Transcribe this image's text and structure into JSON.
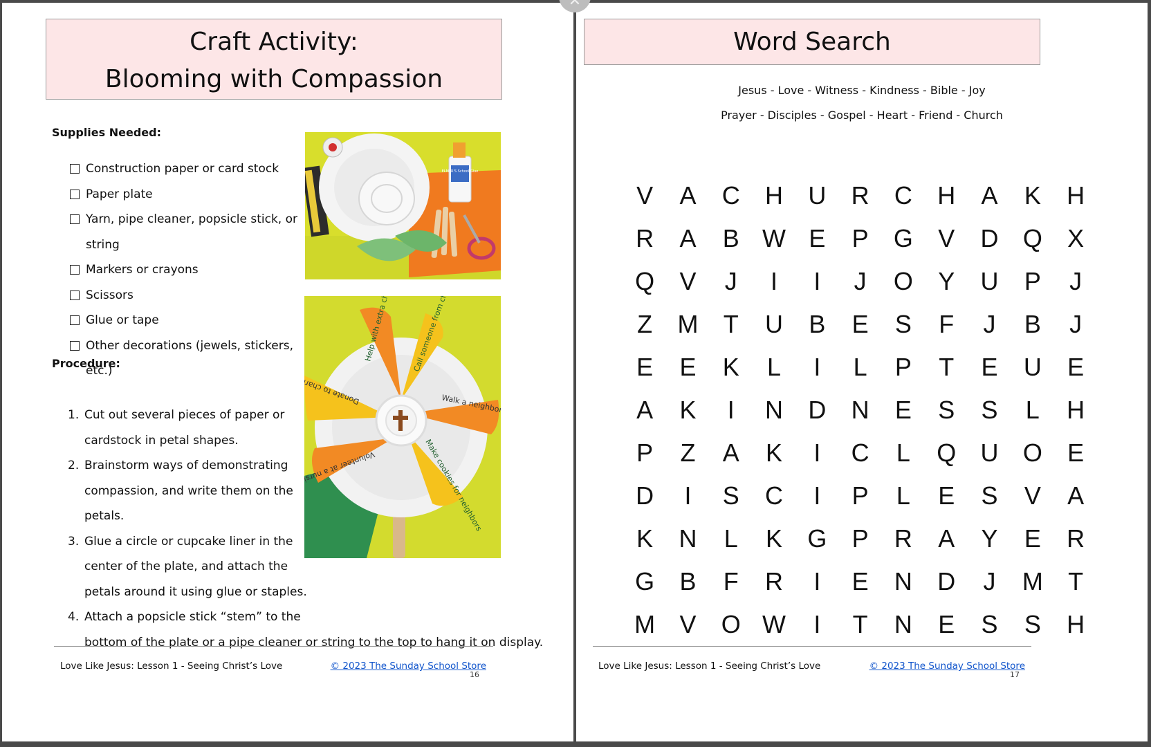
{
  "left_page": {
    "title_line1": "Craft Activity:",
    "title_line2": "Blooming with Compassion",
    "supplies_heading": "Supplies Needed:",
    "supplies": [
      "Construction paper or card stock",
      "Paper plate",
      "Yarn, pipe cleaner, popsicle stick, or",
      "string",
      "Markers or crayons",
      "Scissors",
      "Glue or tape",
      "Other decorations (jewels, stickers, etc.)"
    ],
    "procedure_heading": "Procedure:",
    "procedure": [
      {
        "num": "1.",
        "lines": [
          "Cut out several pieces of paper or",
          "cardstock in petal shapes."
        ]
      },
      {
        "num": "2.",
        "lines": [
          "Brainstorm ways of demonstrating",
          "compassion, and write them on the",
          "petals."
        ]
      },
      {
        "num": "3.",
        "lines": [
          "Glue a circle or cupcake liner in the",
          "center of the plate, and attach the",
          "petals around it using glue or staples."
        ]
      },
      {
        "num": "4.",
        "lines": [
          "Attach a popsicle stick “stem” to the",
          "bottom of the plate or a pipe cleaner or string to the top to hang it on display."
        ]
      }
    ],
    "glue_label": "ELMER'S School Glue",
    "petal_texts": [
      "Help with extra chores",
      "Call someone from church",
      "Walk a neighbor's Dog",
      "Make cookies for neighbors",
      "Volunteer at a nursing home",
      "Donate to charity"
    ],
    "footer_left": "Love Like Jesus: Lesson 1 - Seeing Christ’s Love",
    "footer_right": "© 2023 The Sunday School Store",
    "page_number": "16"
  },
  "right_page": {
    "title": "Word Search",
    "words_line1": "Jesus - Love - Witness - Kindness - Bible - Joy",
    "words_line2": "Prayer - Disciples - Gospel - Heart - Friend - Church",
    "grid": [
      [
        "V",
        "A",
        "C",
        "H",
        "U",
        "R",
        "C",
        "H",
        "A",
        "K",
        "H"
      ],
      [
        "R",
        "A",
        "B",
        "W",
        "E",
        "P",
        "G",
        "V",
        "D",
        "Q",
        "X"
      ],
      [
        "Q",
        "V",
        "J",
        "I",
        "I",
        "J",
        "O",
        "Y",
        "U",
        "P",
        "J"
      ],
      [
        "Z",
        "M",
        "T",
        "U",
        "B",
        "E",
        "S",
        "F",
        "J",
        "B",
        "J"
      ],
      [
        "E",
        "E",
        "K",
        "L",
        "I",
        "L",
        "P",
        "T",
        "E",
        "U",
        "E"
      ],
      [
        "A",
        "K",
        "I",
        "N",
        "D",
        "N",
        "E",
        "S",
        "S",
        "L",
        "H"
      ],
      [
        "P",
        "Z",
        "A",
        "K",
        "I",
        "C",
        "L",
        "Q",
        "U",
        "O",
        "E"
      ],
      [
        "D",
        "I",
        "S",
        "C",
        "I",
        "P",
        "L",
        "E",
        "S",
        "V",
        "A"
      ],
      [
        "K",
        "N",
        "L",
        "K",
        "G",
        "P",
        "R",
        "A",
        "Y",
        "E",
        "R"
      ],
      [
        "G",
        "B",
        "F",
        "R",
        "I",
        "E",
        "N",
        "D",
        "J",
        "M",
        "T"
      ],
      [
        "M",
        "V",
        "O",
        "W",
        "I",
        "T",
        "N",
        "E",
        "S",
        "S",
        "H"
      ]
    ],
    "footer_left": "Love Like Jesus: Lesson 1 - Seeing Christ’s Love",
    "footer_right": "© 2023 The Sunday School Store",
    "page_number": "17"
  },
  "viewer": {
    "close_glyph": "✕"
  },
  "colors": {
    "title_bg": "#fde6e7",
    "link": "#1155cc",
    "page_bg": "#ffffff",
    "viewer_bg": "#4a4a4a"
  }
}
